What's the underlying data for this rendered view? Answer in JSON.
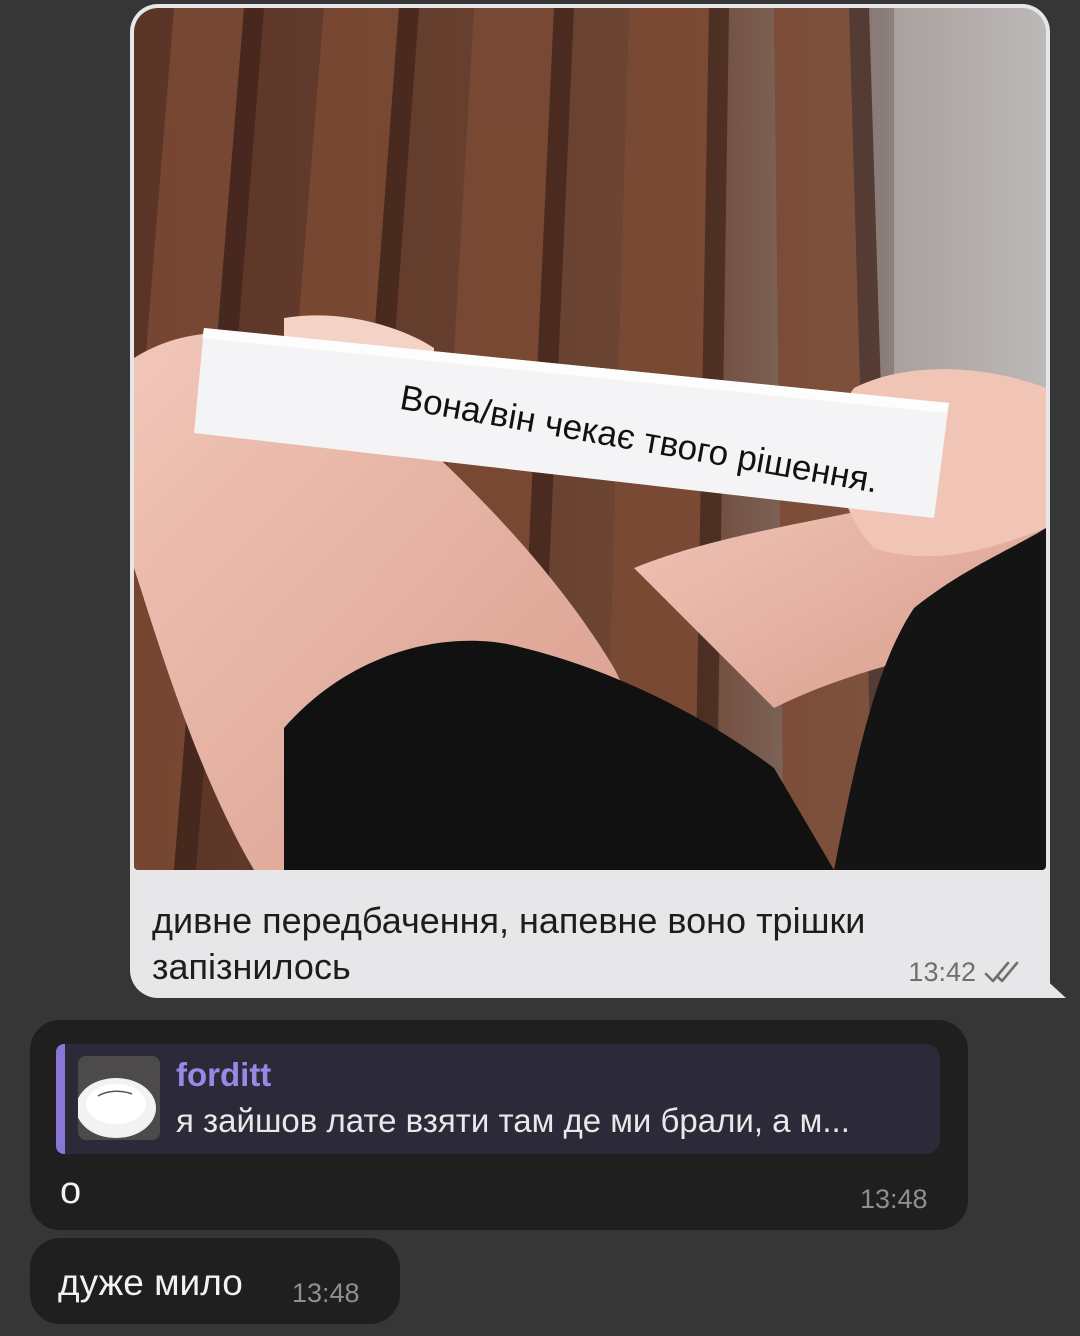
{
  "outgoing_message": {
    "photo_text": "Вона/він чекає твого рішення.",
    "caption": "дивне передбачення, напевне воно трішки запізнилось",
    "time": "13:42",
    "status": "read",
    "status_icon": "double-check-icon"
  },
  "reply_message": {
    "quoted": {
      "author": "forditt",
      "preview": "я зайшов лате взяти там де ми брали, а м..."
    },
    "text": "о",
    "time": "13:48"
  },
  "message_3": {
    "text": "дуже мило",
    "time": "13:48"
  },
  "colors": {
    "background": "#363636",
    "outgoing_bubble": "#e7e7e9",
    "incoming_bubble": "#1f1f1f",
    "quote_accent": "#8a76d6",
    "quote_author": "#9a87e6"
  }
}
